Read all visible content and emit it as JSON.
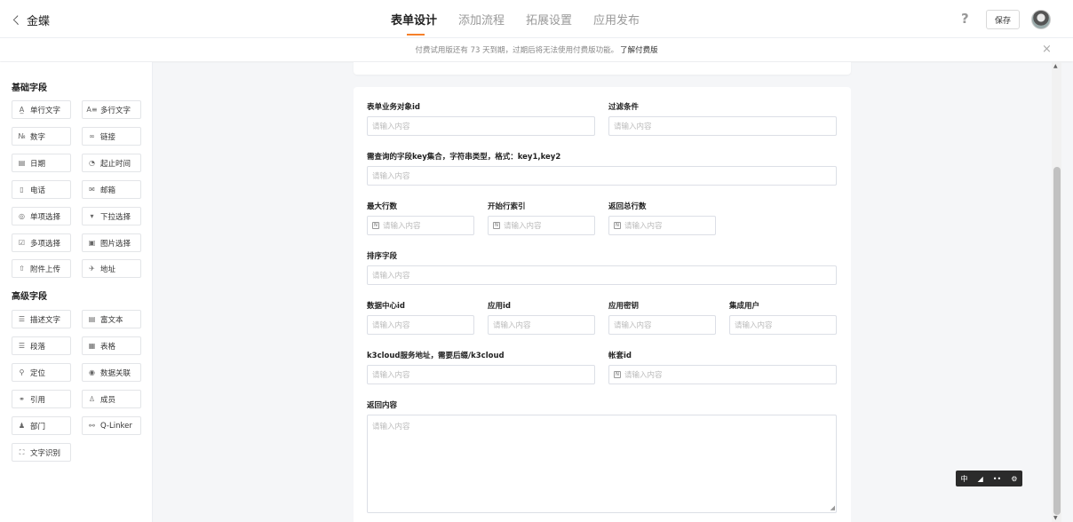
{
  "header": {
    "back_glyph": "ㄑ",
    "app_title": "金蝶",
    "tabs": [
      "表单设计",
      "添加流程",
      "拓展设置",
      "应用发布"
    ],
    "active_tab": 0,
    "help_icon": "?",
    "save_label": "保存"
  },
  "notice": {
    "text": "付费试用版还有 73 天到期，过期后将无法使用付费版功能。",
    "link": "了解付费版",
    "close": "×"
  },
  "sidebar": {
    "basic_title": "基础字段",
    "basic": [
      {
        "icon": "text-line-icon",
        "glyph": "A̲",
        "label": "单行文字"
      },
      {
        "icon": "text-multi-icon",
        "glyph": "A≡",
        "label": "多行文字"
      },
      {
        "icon": "number-icon",
        "glyph": "№",
        "label": "数字"
      },
      {
        "icon": "link-icon",
        "glyph": "∞",
        "label": "链接"
      },
      {
        "icon": "date-icon",
        "glyph": "▤",
        "label": "日期"
      },
      {
        "icon": "time-range-icon",
        "glyph": "◔",
        "label": "起止时间"
      },
      {
        "icon": "phone-icon",
        "glyph": "▯",
        "label": "电话"
      },
      {
        "icon": "mail-icon",
        "glyph": "✉",
        "label": "邮箱"
      },
      {
        "icon": "radio-icon",
        "glyph": "◎",
        "label": "单项选择"
      },
      {
        "icon": "dropdown-icon",
        "glyph": "▾",
        "label": "下拉选择"
      },
      {
        "icon": "checkbox-icon",
        "glyph": "☑",
        "label": "多项选择"
      },
      {
        "icon": "image-select-icon",
        "glyph": "▣",
        "label": "图片选择"
      },
      {
        "icon": "upload-icon",
        "glyph": "⇧",
        "label": "附件上传"
      },
      {
        "icon": "location-icon",
        "glyph": "✈",
        "label": "地址"
      }
    ],
    "advanced_title": "高级字段",
    "advanced": [
      {
        "icon": "description-icon",
        "glyph": "☰",
        "label": "描述文字"
      },
      {
        "icon": "rich-text-icon",
        "glyph": "▤",
        "label": "富文本"
      },
      {
        "icon": "paragraph-icon",
        "glyph": "☰",
        "label": "段落"
      },
      {
        "icon": "table-icon",
        "glyph": "▦",
        "label": "表格"
      },
      {
        "icon": "position-icon",
        "glyph": "⚲",
        "label": "定位"
      },
      {
        "icon": "data-link-icon",
        "glyph": "◉",
        "label": "数据关联"
      },
      {
        "icon": "reference-icon",
        "glyph": "⚭",
        "label": "引用"
      },
      {
        "icon": "member-icon",
        "glyph": "♙",
        "label": "成员"
      },
      {
        "icon": "department-icon",
        "glyph": "♟",
        "label": "部门"
      },
      {
        "icon": "q-linker-icon",
        "glyph": "⚯",
        "label": "Q-Linker"
      },
      {
        "icon": "ocr-icon",
        "glyph": "⛶",
        "label": "文字识别"
      }
    ]
  },
  "form": {
    "placeholder": "请输入内容",
    "fields": {
      "object_id": "表单业务对象id",
      "filter": "过滤条件",
      "field_keys": "需查询的字段key集合，字符串类型，格式：key1,key2",
      "max_rows": "最大行数",
      "start_index": "开始行索引",
      "total_rows": "返回总行数",
      "sort_field": "排序字段",
      "datacenter_id": "数据中心id",
      "app_id": "应用id",
      "app_secret": "应用密钥",
      "integration_user": "集成用户",
      "k3cloud_url": "k3cloud服务地址，需要后缀/k3cloud",
      "account_id": "帐套id",
      "return_content": "返回内容"
    }
  },
  "float_toolbar": [
    "中",
    "◢",
    "••",
    "⚙"
  ]
}
